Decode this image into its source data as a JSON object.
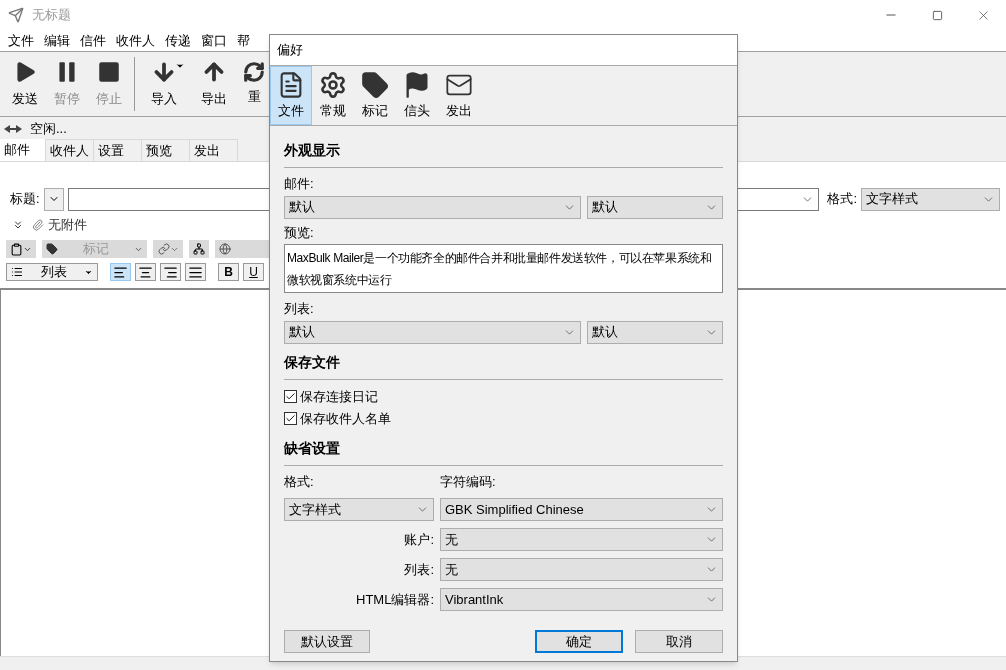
{
  "window": {
    "title": "无标题"
  },
  "menu": [
    "文件",
    "编辑",
    "信件",
    "收件人",
    "传递",
    "窗口",
    "帮"
  ],
  "toolbar": [
    {
      "kind": "play",
      "label": "发送",
      "disabled": false
    },
    {
      "kind": "pause",
      "label": "暂停",
      "disabled": true
    },
    {
      "kind": "stop",
      "label": "停止",
      "disabled": true
    },
    {
      "kind": "import",
      "label": "导入",
      "disabled": false
    },
    {
      "kind": "export",
      "label": "导出",
      "disabled": false
    },
    {
      "kind": "reset",
      "label": "重",
      "disabled": false
    }
  ],
  "status": "空闲...",
  "tabs": [
    {
      "label": "邮件",
      "selected": true
    },
    {
      "label": "收件人",
      "selected": false
    },
    {
      "label": "设置",
      "selected": false
    },
    {
      "label": "预览",
      "selected": false
    },
    {
      "label": "发出",
      "selected": false
    }
  ],
  "subject": {
    "label": "标题:",
    "format_label": "格式:",
    "format_value": "文字样式"
  },
  "attachments": "无附件",
  "format_bar": {
    "tag_select": "标记",
    "list_select": "列表",
    "align": [
      {
        "kind": "left",
        "selected": true
      },
      {
        "kind": "center",
        "selected": false
      },
      {
        "kind": "right",
        "selected": false
      },
      {
        "kind": "justify",
        "selected": false
      }
    ],
    "bold": "B",
    "underline": "U"
  },
  "dialog": {
    "title": "偏好",
    "tabs": [
      {
        "kind": "document",
        "label": "文件",
        "selected": true
      },
      {
        "kind": "gear",
        "label": "常规",
        "selected": false
      },
      {
        "kind": "tag",
        "label": "标记",
        "selected": false
      },
      {
        "kind": "flag",
        "label": "信头",
        "selected": false
      },
      {
        "kind": "mail",
        "label": "发出",
        "selected": false
      }
    ],
    "appearance": {
      "heading": "外观显示",
      "mail_label": "邮件:",
      "mail_values": [
        "默认",
        "默认"
      ],
      "preview_label": "预览:",
      "preview_text": "MaxBulk Mailer是一个功能齐全的邮件合并和批量邮件发送软件，可以在苹果系统和微软视窗系统中运行",
      "list_label": "列表:",
      "list_values": [
        "默认",
        "默认"
      ]
    },
    "save_files": {
      "heading": "保存文件",
      "options": [
        {
          "label": "保存连接日记",
          "checked": true
        },
        {
          "label": "保存收件人名单",
          "checked": true
        }
      ]
    },
    "defaults": {
      "heading": "缺省设置",
      "format_label": "格式:",
      "format_value": "文字样式",
      "encoding_label": "字符编码:",
      "encoding_value": "GBK Simplified Chinese",
      "rows": [
        {
          "label": "账户:",
          "value": "无"
        },
        {
          "label": "列表:",
          "value": "无"
        },
        {
          "label": "HTML编辑器:",
          "value": "VibrantInk"
        }
      ]
    },
    "buttons": {
      "defaults": "默认设置",
      "ok": "确定",
      "cancel": "取消"
    }
  }
}
